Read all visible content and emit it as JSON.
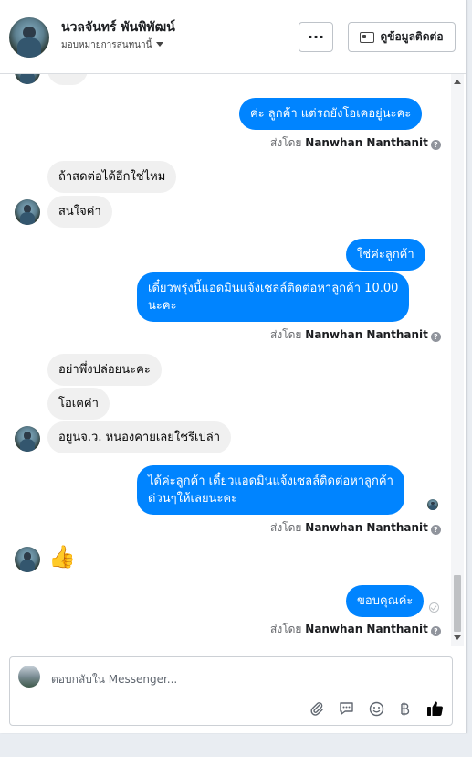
{
  "header": {
    "contact_name": "นวลจันทร์ พันพิพัฒน์",
    "assigned_label": "มอบหมายการสนทนานี้",
    "more_label": "···",
    "contact_info_label": "ดูข้อมูลติดต่อ"
  },
  "thread": {
    "sent_by_prefix": "ส่งโดย",
    "agent_name": "Nanwhan Nanthanit",
    "messages": [
      {
        "dir": "out",
        "text": "ค่ะ ลูกค้า แต่รถยังโอเคอยู่นะคะ"
      },
      {
        "dir": "in",
        "text": "ถ้าสดต่อได้อีกใช่ไหม"
      },
      {
        "dir": "in",
        "text": "สนใจค่า"
      },
      {
        "dir": "out",
        "text": "ใช่ค่ะลูกค้า"
      },
      {
        "dir": "out",
        "line1": "เดี๋ยวพรุ่งนี้แอดมินแจ้งเซลล์ติดต่อหาลูกค้า 10.00",
        "line2": "นะคะ"
      },
      {
        "dir": "in",
        "text": "อย่าพึ่งปล่อยนะคะ"
      },
      {
        "dir": "in",
        "text": "โอเคค่า"
      },
      {
        "dir": "in",
        "text": "อยูนจ.ว. หนองคายเลยใชรึเปล่า"
      },
      {
        "dir": "out",
        "line1": "ได้ค่ะลูกค้า เดี๋ยวแอดมินแจ้งเซลล์ติดต่อหาลูกค้า",
        "line2": "ด่วนๆให้เลยนะคะ"
      },
      {
        "dir": "in",
        "text": "👍"
      },
      {
        "dir": "out",
        "text": "ขอบคุณค่ะ"
      }
    ]
  },
  "composer": {
    "placeholder": "ตอบกลับใน Messenger..."
  },
  "colors": {
    "outgoing_bubble": "#0084ff",
    "incoming_bubble": "#f0f0f0",
    "like": "#050505"
  },
  "icons": [
    "attachment-icon",
    "saved-reply-icon",
    "emoji-icon",
    "baht-icon",
    "like-icon",
    "info-icon"
  ]
}
